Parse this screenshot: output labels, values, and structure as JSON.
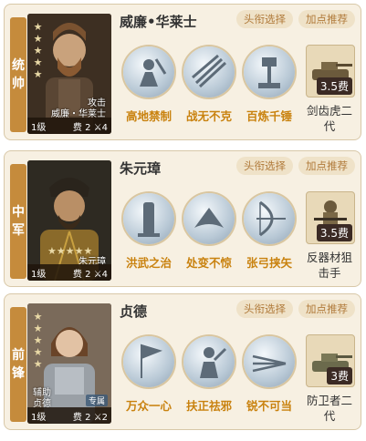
{
  "buttons": {
    "title_select": "头衔选择",
    "points_recommend": "加点推荐"
  },
  "cards": [
    {
      "role": [
        "统",
        "帅"
      ],
      "name": "威廉•华莱士",
      "portrait": {
        "stars": "★★★★★",
        "tag": "攻击",
        "name": "威廉・华莱士",
        "level": "1级",
        "cost_label": "费",
        "cost": "2",
        "troops": "4"
      },
      "skills": [
        "高地禁制",
        "战无不克",
        "百炼千锤"
      ],
      "equip": {
        "cost": "3.5费",
        "name": "剑齿虎二代"
      }
    },
    {
      "role": [
        "中",
        "军"
      ],
      "name": "朱元璋",
      "portrait": {
        "stars": "★★★★★",
        "tag": "",
        "name": "朱元璋",
        "level": "1级",
        "cost_label": "费",
        "cost": "2",
        "troops": "4"
      },
      "skills": [
        "洪武之治",
        "处变不惊",
        "张弓挟矢"
      ],
      "equip": {
        "cost": "3.5费",
        "name": "反器材狙击手"
      }
    },
    {
      "role": [
        "前",
        "锋"
      ],
      "name": "贞德",
      "portrait": {
        "stars": "★★★★★",
        "tag": "辅助",
        "name": "贞德",
        "level": "1级",
        "cost_label": "费",
        "cost": "2",
        "troops": "2",
        "special": "专属"
      },
      "skills": [
        "万众一心",
        "扶正祛邪",
        "锐不可当"
      ],
      "equip": {
        "cost": "3费",
        "name": "防卫者二代"
      }
    }
  ]
}
